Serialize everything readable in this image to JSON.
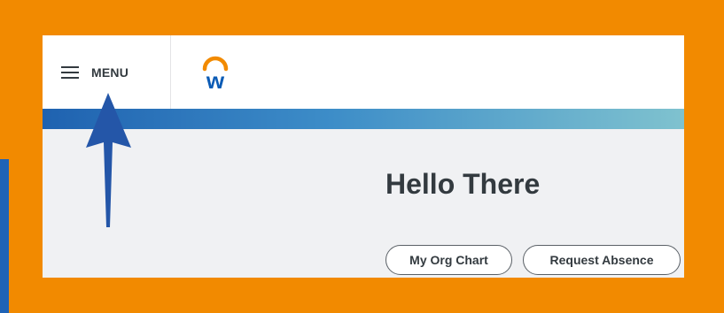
{
  "header": {
    "menu_label": "MENU",
    "logo_letter": "w"
  },
  "main": {
    "greeting": "Hello There",
    "actions": [
      {
        "label": "My Org Chart"
      },
      {
        "label": "Request Absence"
      }
    ]
  },
  "colors": {
    "frame_border": "#f28a00",
    "band_start": "#1f62b0",
    "band_end": "#7fc2cf",
    "arrow": "#2456a8",
    "text": "#333a3f"
  }
}
